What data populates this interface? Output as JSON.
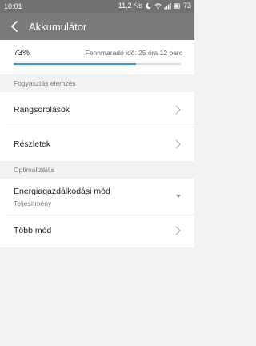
{
  "status": {
    "time": "10:01",
    "net_speed": "11,2 ᴷ/s",
    "battery": "73",
    "icons": [
      "data-speed",
      "moon-icon",
      "wifi-icon",
      "signal-icon",
      "battery-icon"
    ]
  },
  "header": {
    "title": "Akkumulátor"
  },
  "battery": {
    "percent": "73%",
    "remaining": "Fennmaradó idő: 25 óra 12 perc",
    "level": 0.73
  },
  "sections": {
    "consumption": "Fogyasztás elemzés",
    "optimization": "Optimalizálás"
  },
  "items": {
    "ranking": "Rangsorolások",
    "details": "Részletek",
    "power_mode": "Energiagazdálkodási mód",
    "power_mode_value": "Teljesítmény",
    "more_modes": "Több mód"
  },
  "colors": {
    "accent": "#2f9be8",
    "titlebar": "#7a7a7a",
    "statusbar": "#727272"
  }
}
